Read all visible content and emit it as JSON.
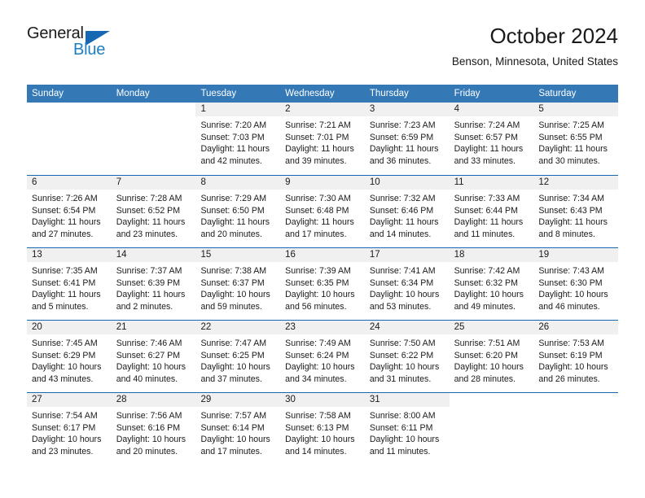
{
  "brand": {
    "name_part1": "General",
    "name_part2": "Blue",
    "logo_icon": "triangle-logo-icon"
  },
  "header": {
    "title": "October 2024",
    "subtitle": "Benson, Minnesota, United States"
  },
  "colors": {
    "header_blue": "#3479b5",
    "row_separator_blue": "#1668b3",
    "daynum_band_gray": "#f0f0f0",
    "brand_blue": "#1d7ec4"
  },
  "weekdays": [
    "Sunday",
    "Monday",
    "Tuesday",
    "Wednesday",
    "Thursday",
    "Friday",
    "Saturday"
  ],
  "weeks": [
    [
      {
        "day": "",
        "lines": []
      },
      {
        "day": "",
        "lines": []
      },
      {
        "day": "1",
        "lines": [
          "Sunrise: 7:20 AM",
          "Sunset: 7:03 PM",
          "Daylight: 11 hours",
          "and 42 minutes."
        ]
      },
      {
        "day": "2",
        "lines": [
          "Sunrise: 7:21 AM",
          "Sunset: 7:01 PM",
          "Daylight: 11 hours",
          "and 39 minutes."
        ]
      },
      {
        "day": "3",
        "lines": [
          "Sunrise: 7:23 AM",
          "Sunset: 6:59 PM",
          "Daylight: 11 hours",
          "and 36 minutes."
        ]
      },
      {
        "day": "4",
        "lines": [
          "Sunrise: 7:24 AM",
          "Sunset: 6:57 PM",
          "Daylight: 11 hours",
          "and 33 minutes."
        ]
      },
      {
        "day": "5",
        "lines": [
          "Sunrise: 7:25 AM",
          "Sunset: 6:55 PM",
          "Daylight: 11 hours",
          "and 30 minutes."
        ]
      }
    ],
    [
      {
        "day": "6",
        "lines": [
          "Sunrise: 7:26 AM",
          "Sunset: 6:54 PM",
          "Daylight: 11 hours",
          "and 27 minutes."
        ]
      },
      {
        "day": "7",
        "lines": [
          "Sunrise: 7:28 AM",
          "Sunset: 6:52 PM",
          "Daylight: 11 hours",
          "and 23 minutes."
        ]
      },
      {
        "day": "8",
        "lines": [
          "Sunrise: 7:29 AM",
          "Sunset: 6:50 PM",
          "Daylight: 11 hours",
          "and 20 minutes."
        ]
      },
      {
        "day": "9",
        "lines": [
          "Sunrise: 7:30 AM",
          "Sunset: 6:48 PM",
          "Daylight: 11 hours",
          "and 17 minutes."
        ]
      },
      {
        "day": "10",
        "lines": [
          "Sunrise: 7:32 AM",
          "Sunset: 6:46 PM",
          "Daylight: 11 hours",
          "and 14 minutes."
        ]
      },
      {
        "day": "11",
        "lines": [
          "Sunrise: 7:33 AM",
          "Sunset: 6:44 PM",
          "Daylight: 11 hours",
          "and 11 minutes."
        ]
      },
      {
        "day": "12",
        "lines": [
          "Sunrise: 7:34 AM",
          "Sunset: 6:43 PM",
          "Daylight: 11 hours",
          "and 8 minutes."
        ]
      }
    ],
    [
      {
        "day": "13",
        "lines": [
          "Sunrise: 7:35 AM",
          "Sunset: 6:41 PM",
          "Daylight: 11 hours",
          "and 5 minutes."
        ]
      },
      {
        "day": "14",
        "lines": [
          "Sunrise: 7:37 AM",
          "Sunset: 6:39 PM",
          "Daylight: 11 hours",
          "and 2 minutes."
        ]
      },
      {
        "day": "15",
        "lines": [
          "Sunrise: 7:38 AM",
          "Sunset: 6:37 PM",
          "Daylight: 10 hours",
          "and 59 minutes."
        ]
      },
      {
        "day": "16",
        "lines": [
          "Sunrise: 7:39 AM",
          "Sunset: 6:35 PM",
          "Daylight: 10 hours",
          "and 56 minutes."
        ]
      },
      {
        "day": "17",
        "lines": [
          "Sunrise: 7:41 AM",
          "Sunset: 6:34 PM",
          "Daylight: 10 hours",
          "and 53 minutes."
        ]
      },
      {
        "day": "18",
        "lines": [
          "Sunrise: 7:42 AM",
          "Sunset: 6:32 PM",
          "Daylight: 10 hours",
          "and 49 minutes."
        ]
      },
      {
        "day": "19",
        "lines": [
          "Sunrise: 7:43 AM",
          "Sunset: 6:30 PM",
          "Daylight: 10 hours",
          "and 46 minutes."
        ]
      }
    ],
    [
      {
        "day": "20",
        "lines": [
          "Sunrise: 7:45 AM",
          "Sunset: 6:29 PM",
          "Daylight: 10 hours",
          "and 43 minutes."
        ]
      },
      {
        "day": "21",
        "lines": [
          "Sunrise: 7:46 AM",
          "Sunset: 6:27 PM",
          "Daylight: 10 hours",
          "and 40 minutes."
        ]
      },
      {
        "day": "22",
        "lines": [
          "Sunrise: 7:47 AM",
          "Sunset: 6:25 PM",
          "Daylight: 10 hours",
          "and 37 minutes."
        ]
      },
      {
        "day": "23",
        "lines": [
          "Sunrise: 7:49 AM",
          "Sunset: 6:24 PM",
          "Daylight: 10 hours",
          "and 34 minutes."
        ]
      },
      {
        "day": "24",
        "lines": [
          "Sunrise: 7:50 AM",
          "Sunset: 6:22 PM",
          "Daylight: 10 hours",
          "and 31 minutes."
        ]
      },
      {
        "day": "25",
        "lines": [
          "Sunrise: 7:51 AM",
          "Sunset: 6:20 PM",
          "Daylight: 10 hours",
          "and 28 minutes."
        ]
      },
      {
        "day": "26",
        "lines": [
          "Sunrise: 7:53 AM",
          "Sunset: 6:19 PM",
          "Daylight: 10 hours",
          "and 26 minutes."
        ]
      }
    ],
    [
      {
        "day": "27",
        "lines": [
          "Sunrise: 7:54 AM",
          "Sunset: 6:17 PM",
          "Daylight: 10 hours",
          "and 23 minutes."
        ]
      },
      {
        "day": "28",
        "lines": [
          "Sunrise: 7:56 AM",
          "Sunset: 6:16 PM",
          "Daylight: 10 hours",
          "and 20 minutes."
        ]
      },
      {
        "day": "29",
        "lines": [
          "Sunrise: 7:57 AM",
          "Sunset: 6:14 PM",
          "Daylight: 10 hours",
          "and 17 minutes."
        ]
      },
      {
        "day": "30",
        "lines": [
          "Sunrise: 7:58 AM",
          "Sunset: 6:13 PM",
          "Daylight: 10 hours",
          "and 14 minutes."
        ]
      },
      {
        "day": "31",
        "lines": [
          "Sunrise: 8:00 AM",
          "Sunset: 6:11 PM",
          "Daylight: 10 hours",
          "and 11 minutes."
        ]
      },
      {
        "day": "",
        "lines": []
      },
      {
        "day": "",
        "lines": []
      }
    ]
  ]
}
